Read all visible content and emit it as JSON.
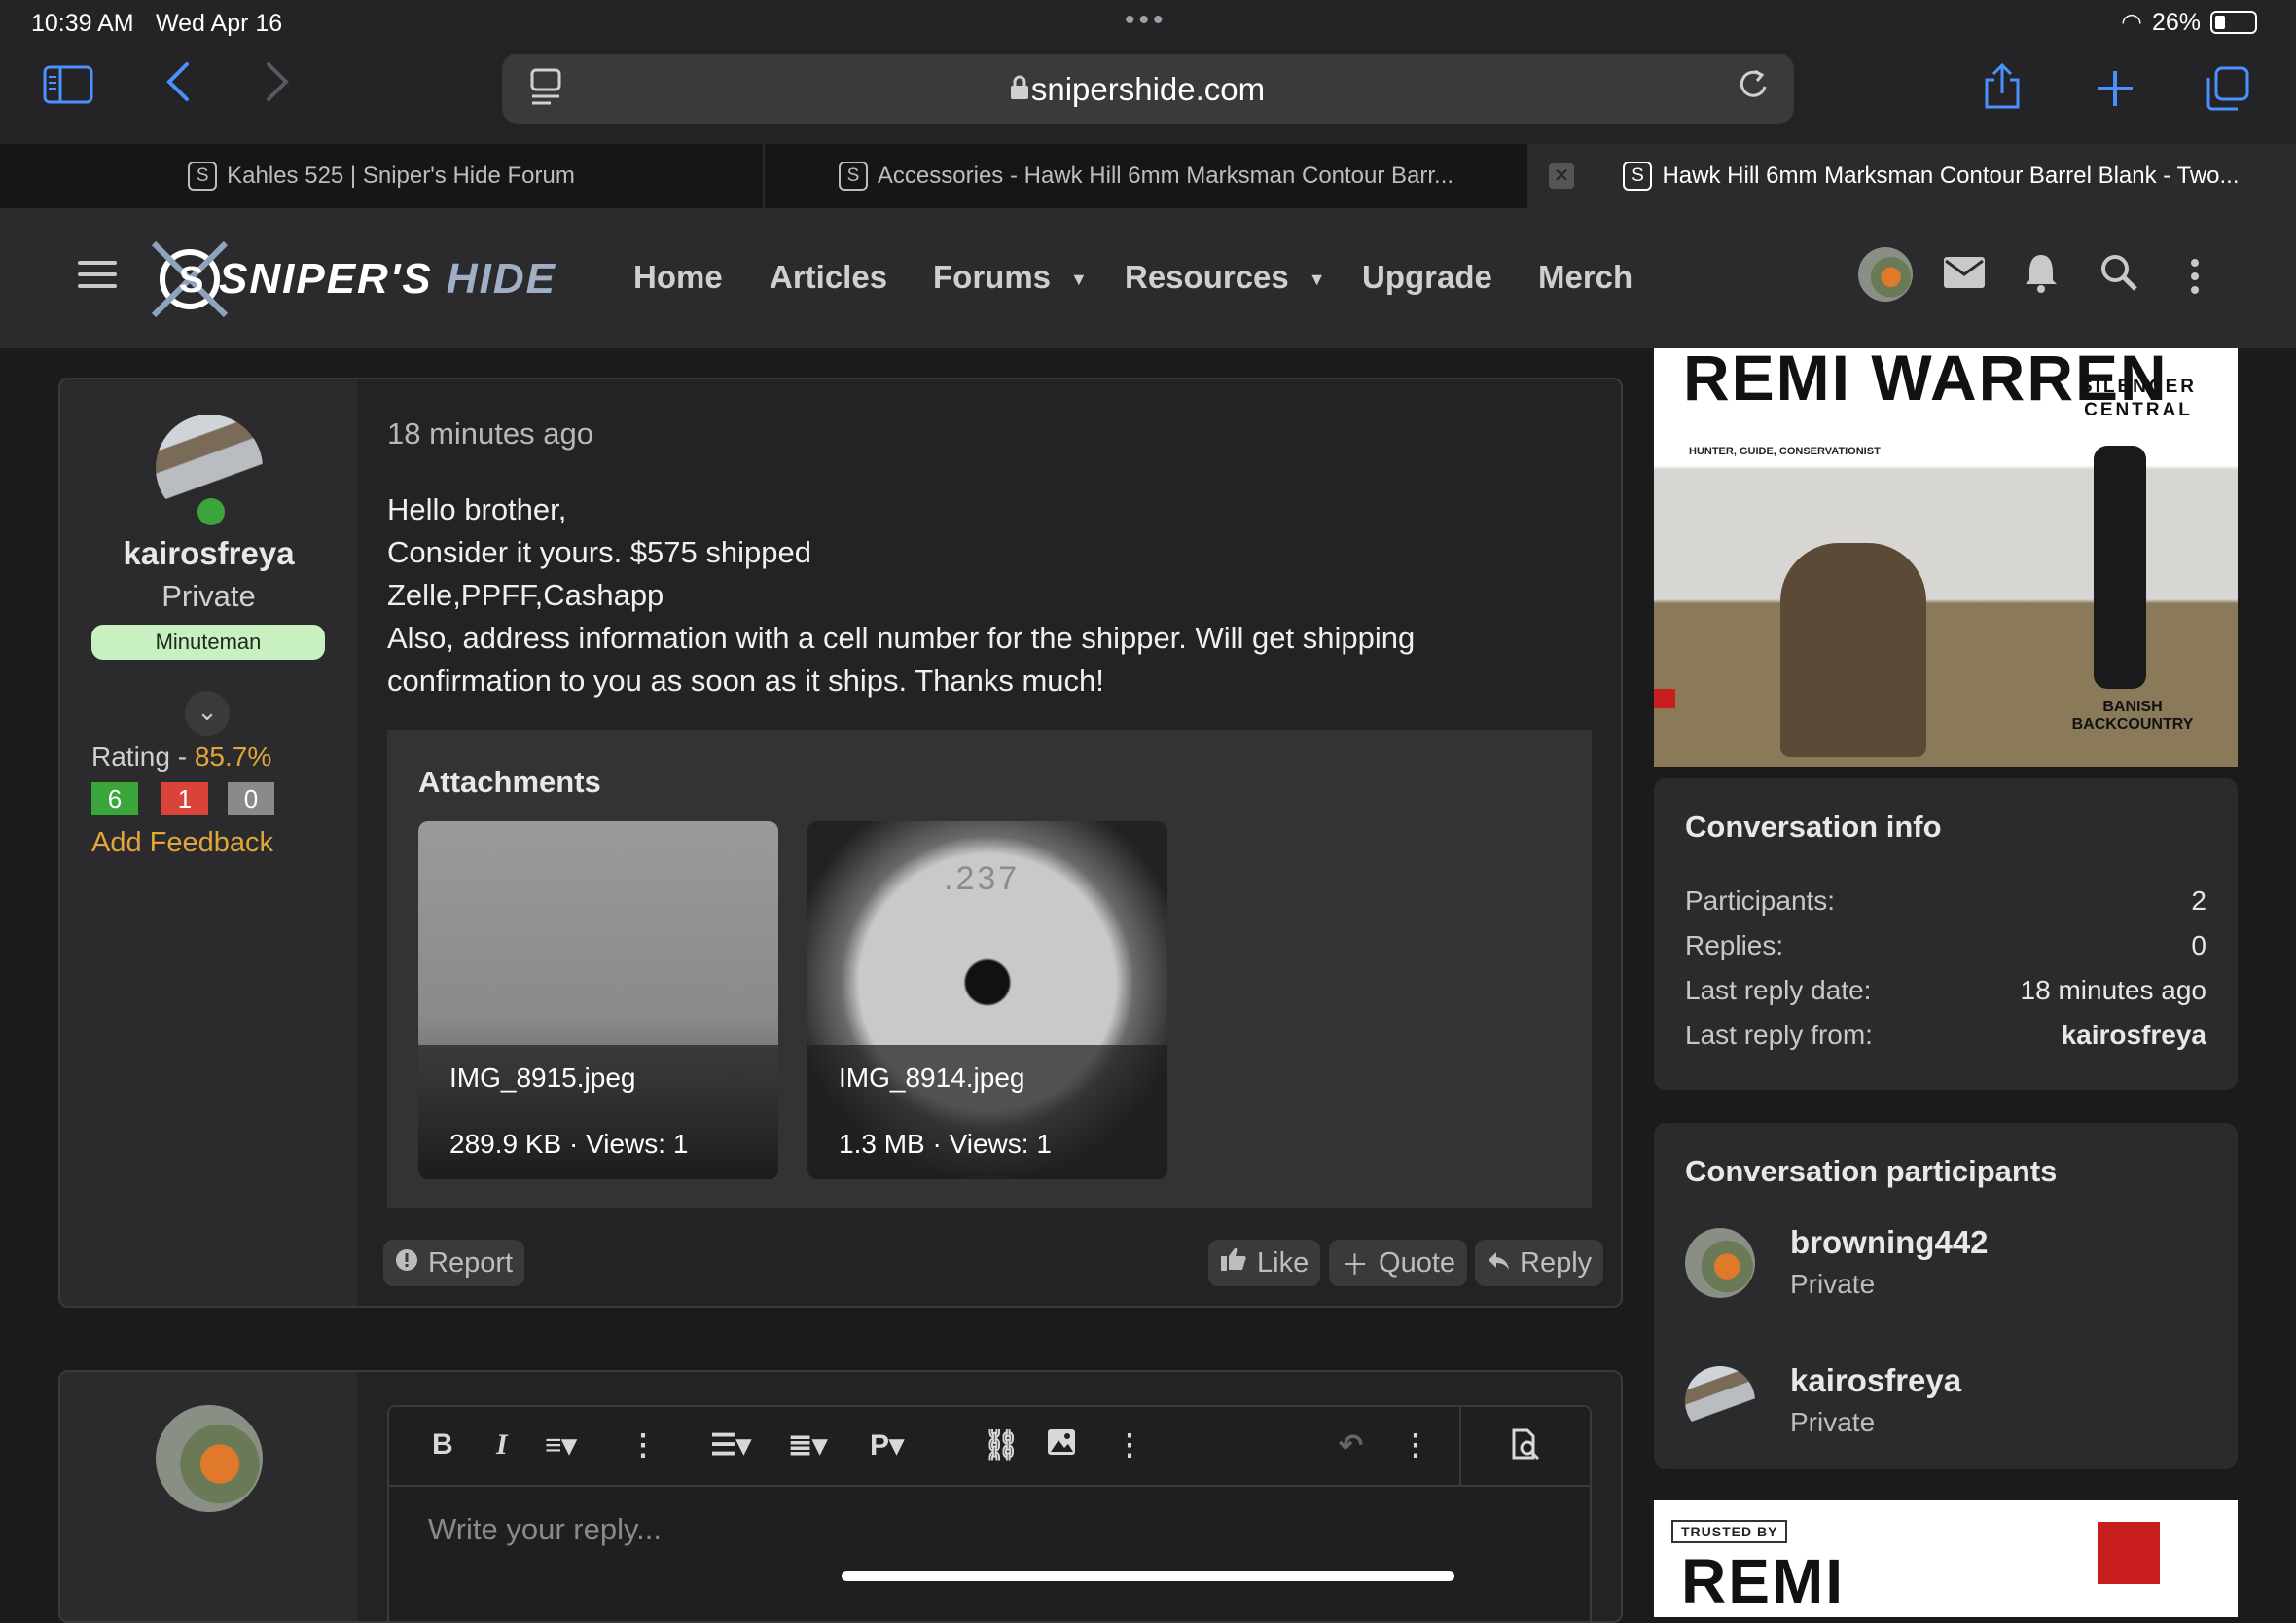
{
  "status_bar": {
    "time": "10:39 AM",
    "date": "Wed Apr 16",
    "battery": "26%"
  },
  "browser": {
    "url": "snipershide.com",
    "tabs": [
      {
        "label": "Kahles 525 | Sniper's Hide Forum",
        "favicon": "S"
      },
      {
        "label": "Accessories - Hawk Hill 6mm Marksman Contour Barr...",
        "favicon": "S"
      },
      {
        "label": "Hawk Hill 6mm Marksman Contour Barrel Blank - Two...",
        "favicon": "S"
      }
    ]
  },
  "site": {
    "logo_primary": "SNIPER'S",
    "logo_secondary": "HIDE",
    "nav": [
      "Home",
      "Articles",
      "Forums",
      "Resources",
      "Upgrade",
      "Merch"
    ]
  },
  "post": {
    "username": "kairosfreya",
    "rank": "Private",
    "badge": "Minuteman",
    "rating_label": "Rating - ",
    "rating_value": "85.7%",
    "feedback": {
      "positive": "6",
      "negative": "1",
      "neutral": "0"
    },
    "add_feedback": "Add Feedback",
    "time": "18 minutes ago",
    "body": [
      "Hello brother,",
      "Consider it yours. $575 shipped",
      "Zelle,PPFF,Cashapp",
      "Also, address information with a cell number for the shipper. Will get shipping confirmation to you as soon as it ships. Thanks much!"
    ],
    "attachments_title": "Attachments",
    "attachments": [
      {
        "name": "IMG_8915.jpeg",
        "meta": "289.9 KB · Views: 1"
      },
      {
        "name": "IMG_8914.jpeg",
        "meta": "1.3 MB · Views: 1",
        "stamp": ".237"
      }
    ],
    "actions": {
      "report": "Report",
      "like": "Like",
      "quote": "Quote",
      "reply": "Reply"
    }
  },
  "reply_editor": {
    "placeholder": "Write your reply..."
  },
  "sidebar": {
    "ad_top": {
      "name": "REMI WARREN",
      "tagline": "HUNTER, GUIDE, CONSERVATIONIST",
      "brand": "SILENCER CENTRAL",
      "product": "BANISH BACKCOUNTRY"
    },
    "conversation_info": {
      "title": "Conversation info",
      "rows": [
        {
          "label": "Participants:",
          "value": "2"
        },
        {
          "label": "Replies:",
          "value": "0"
        },
        {
          "label": "Last reply date:",
          "value": "18 minutes ago"
        },
        {
          "label": "Last reply from:",
          "value": "kairosfreya"
        }
      ]
    },
    "participants": {
      "title": "Conversation participants",
      "list": [
        {
          "name": "browning442",
          "rank": "Private"
        },
        {
          "name": "kairosfreya",
          "rank": "Private"
        }
      ]
    },
    "ad_bottom": {
      "trusted": "TRUSTED BY",
      "name": "REMI"
    }
  }
}
